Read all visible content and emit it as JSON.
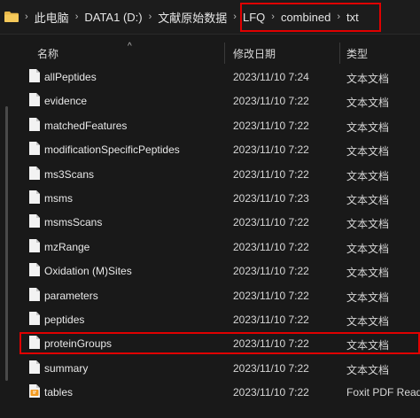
{
  "breadcrumb": {
    "items": [
      "此电脑",
      "DATA1 (D:)",
      "文献原始数据",
      "LFQ",
      "combined",
      "txt"
    ]
  },
  "columns": {
    "name": "名称",
    "modified": "修改日期",
    "type": "类型"
  },
  "colors": {
    "highlight": "#e00000",
    "background": "#191919"
  },
  "files": [
    {
      "name": "allPeptides",
      "modified": "2023/11/10 7:24",
      "type": "文本文档",
      "icon": "text-file-icon"
    },
    {
      "name": "evidence",
      "modified": "2023/11/10 7:22",
      "type": "文本文档",
      "icon": "text-file-icon"
    },
    {
      "name": "matchedFeatures",
      "modified": "2023/11/10 7:22",
      "type": "文本文档",
      "icon": "text-file-icon"
    },
    {
      "name": "modificationSpecificPeptides",
      "modified": "2023/11/10 7:22",
      "type": "文本文档",
      "icon": "text-file-icon"
    },
    {
      "name": "ms3Scans",
      "modified": "2023/11/10 7:22",
      "type": "文本文档",
      "icon": "text-file-icon"
    },
    {
      "name": "msms",
      "modified": "2023/11/10 7:23",
      "type": "文本文档",
      "icon": "text-file-icon"
    },
    {
      "name": "msmsScans",
      "modified": "2023/11/10 7:22",
      "type": "文本文档",
      "icon": "text-file-icon"
    },
    {
      "name": "mzRange",
      "modified": "2023/11/10 7:22",
      "type": "文本文档",
      "icon": "text-file-icon"
    },
    {
      "name": "Oxidation (M)Sites",
      "modified": "2023/11/10 7:22",
      "type": "文本文档",
      "icon": "text-file-icon"
    },
    {
      "name": "parameters",
      "modified": "2023/11/10 7:22",
      "type": "文本文档",
      "icon": "text-file-icon"
    },
    {
      "name": "peptides",
      "modified": "2023/11/10 7:22",
      "type": "文本文档",
      "icon": "text-file-icon"
    },
    {
      "name": "proteinGroups",
      "modified": "2023/11/10 7:22",
      "type": "文本文档",
      "icon": "text-file-icon"
    },
    {
      "name": "summary",
      "modified": "2023/11/10 7:22",
      "type": "文本文档",
      "icon": "text-file-icon"
    },
    {
      "name": "tables",
      "modified": "2023/11/10 7:22",
      "type": "Foxit PDF Reader",
      "icon": "pdf-file-icon"
    }
  ]
}
